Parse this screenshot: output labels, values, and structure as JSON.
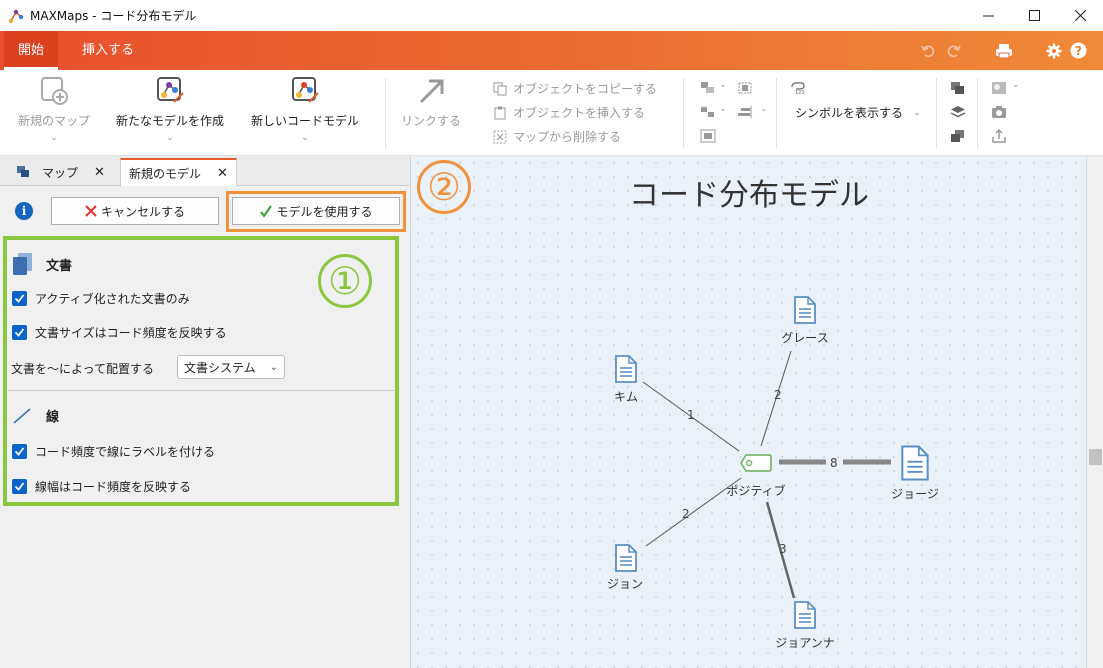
{
  "window": {
    "title": "MAXMaps - コード分布モデル",
    "controls": [
      "minimize",
      "maximize",
      "close"
    ]
  },
  "ribbon_tabs": [
    {
      "label": "開始",
      "active": true
    },
    {
      "label": "挿入する",
      "active": false
    }
  ],
  "ribbon": {
    "new_map": "新規のマップ",
    "new_model": "新たなモデルを作成",
    "new_code_model": "新しいコードモデル",
    "link": "リンクする",
    "copy_object": "オブジェクトをコピーする",
    "insert_object": "オブジェクトを挿入する",
    "delete_from_map": "マップから削除する",
    "show_symbol": "シンボルを表示する"
  },
  "panel": {
    "tabs": [
      {
        "label": "マップ",
        "active": false
      },
      {
        "label": "新規のモデル",
        "active": true
      }
    ],
    "cancel_label": "キャンセルする",
    "use_model_label": "モデルを使用する",
    "callout_1": "①",
    "callout_2": "②",
    "documents_section": {
      "title": "文書",
      "options": [
        {
          "label": "アクティブ化された文書のみ",
          "checked": true
        },
        {
          "label": "文書サイズはコード頻度を反映する",
          "checked": true
        }
      ],
      "arrange_label": "文書を～によって配置する",
      "arrange_value": "文書システム"
    },
    "lines_section": {
      "title": "線",
      "options": [
        {
          "label": "コード頻度で線にラベルを付ける",
          "checked": true
        },
        {
          "label": "線幅はコード頻度を反映する",
          "checked": true
        }
      ]
    }
  },
  "canvas": {
    "title": "コード分布モデル",
    "center_code": "ポジティブ",
    "documents": [
      {
        "name": "グレース",
        "frequency": "2"
      },
      {
        "name": "キム",
        "frequency": "1"
      },
      {
        "name": "ジョージ",
        "frequency": "8"
      },
      {
        "name": "ジョン",
        "frequency": "2"
      },
      {
        "name": "ジョアンナ",
        "frequency": "3"
      }
    ]
  },
  "colors": {
    "accent": "#e85a2e",
    "highlight_orange": "#f2913d",
    "highlight_green": "#8cc63f",
    "checkbox": "#0a64c8",
    "document_icon": "#5b8fc7",
    "code_icon": "#7bb86f"
  }
}
